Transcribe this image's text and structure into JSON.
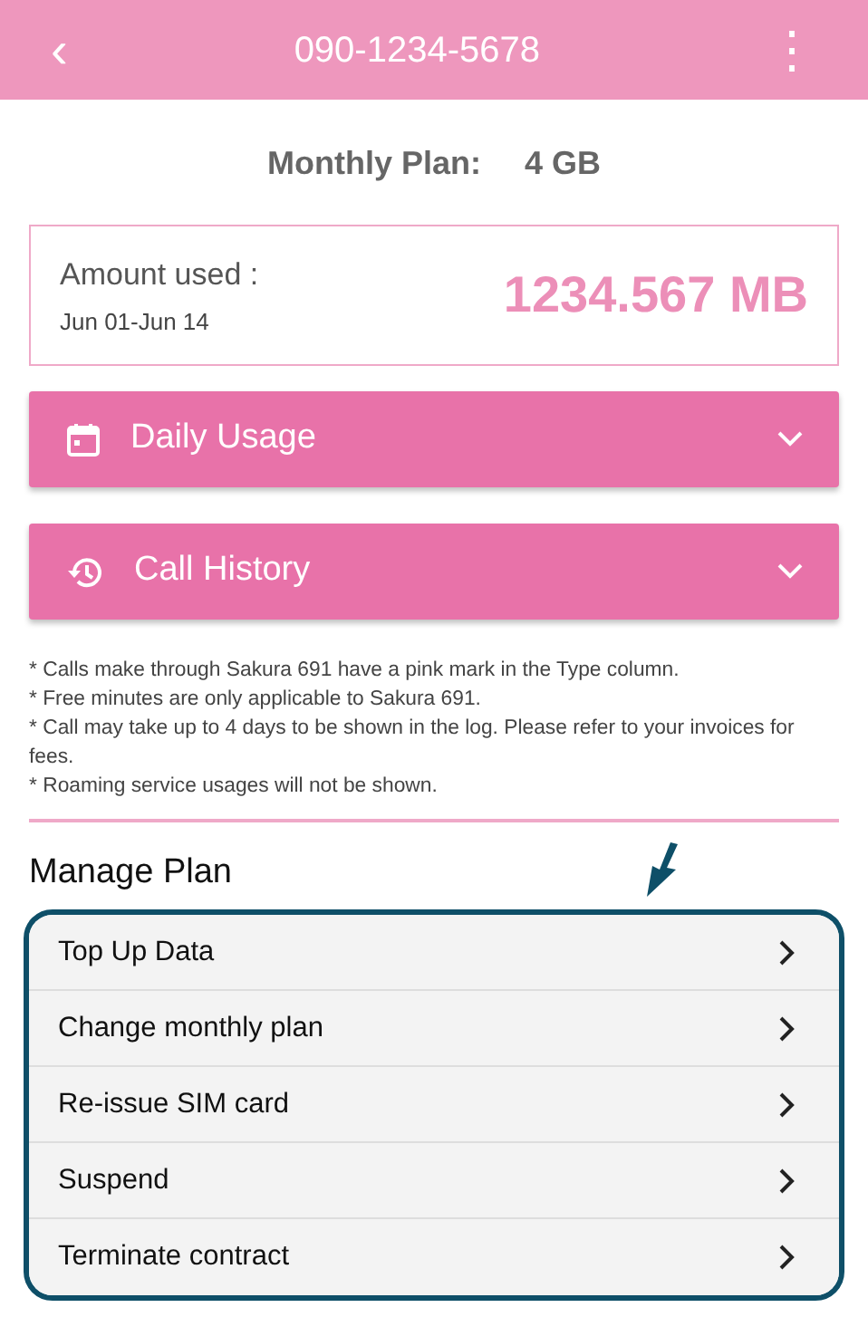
{
  "header": {
    "back": "‹",
    "title": "090-1234-5678",
    "menu": "⋮"
  },
  "plan": {
    "label": "Monthly Plan:",
    "value": "4 GB"
  },
  "usage": {
    "label": "Amount used :",
    "period": "Jun 01-Jun 14",
    "amount": "1234.567 MB"
  },
  "sections": [
    {
      "kind": "calendar",
      "label": "Daily Usage",
      "expanded": false
    },
    {
      "kind": "history",
      "label": "Call History",
      "expanded": false
    }
  ],
  "notes": [
    "* Calls make through Sakura 691 have a pink mark in the Type column.",
    "* Free minutes are only applicable to Sakura 691.",
    "* Call may take up to 4 days to be shown in the log. Please refer to your invoices for fees.",
    "* Roaming service usages will not be shown."
  ],
  "manage": {
    "title": "Manage Plan",
    "items": [
      "Top Up Data",
      "Change monthly plan",
      "Re-issue SIM card",
      "Suspend",
      "Terminate contract"
    ]
  }
}
